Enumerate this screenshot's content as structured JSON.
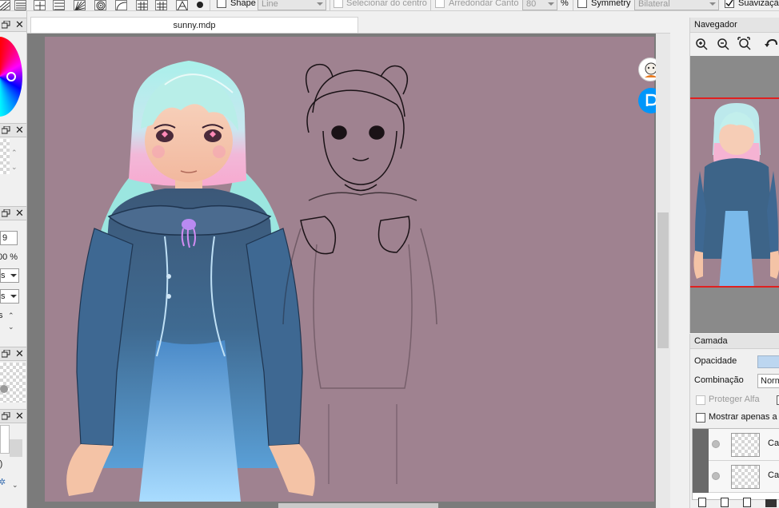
{
  "toolbar": {
    "shape_label": "Shape",
    "shape_value": "Line",
    "select_center_label": "Selecionar do centro",
    "round_corner_label": "Arredondar Canto",
    "round_corner_value": "80",
    "percent_unit": "%",
    "symmetry_label": "Symmetry",
    "symmetry_value": "Bilateral",
    "smoothing_label": "Suavização"
  },
  "canvas": {
    "tab_title": "sunny.mdp",
    "background_color": "#9f8290"
  },
  "left_dock": {
    "field_value": "9",
    "opacity_value": "00 %",
    "combo_1": "s",
    "combo_2": "s",
    "row_label": "s",
    "row_label_2": "-)"
  },
  "navigator": {
    "title": "Navegador"
  },
  "layer_panel": {
    "title": "Camada",
    "opacity_label": "Opacidade",
    "blend_label": "Combinação",
    "blend_value": "Norm",
    "protect_alpha_label": "Proteger Alfa",
    "show_only_label": "Mostrar apenas a c",
    "layers": [
      {
        "name": "Ca"
      },
      {
        "name": "Ca"
      }
    ]
  },
  "colors": {
    "accent_red": "#e02020",
    "canvas_bg": "#9f8290",
    "panel_bg": "#f0f0f0"
  }
}
